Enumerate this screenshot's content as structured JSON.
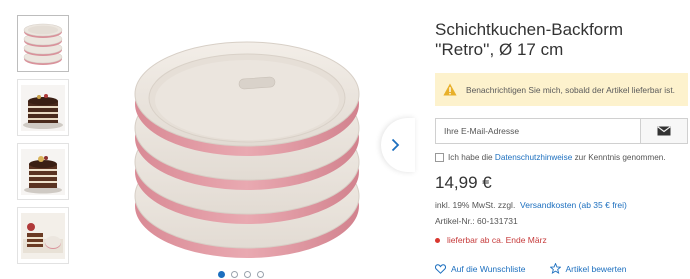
{
  "product": {
    "title_line1": "Schichtkuchen-Backform",
    "title_line2": "''Retro'', Ø 17 cm"
  },
  "notify": {
    "icon": "warning-icon",
    "text": "Benachrichtigen Sie mich, sobald der Artikel lieferbar ist.",
    "email_placeholder": "Ihre E-Mail-Adresse",
    "submit_icon": "envelope-icon"
  },
  "consent": {
    "prefix": "Ich habe die ",
    "link": "Datenschutzhinweise",
    "suffix": " zur Kenntnis genommen."
  },
  "pricing": {
    "price": "14,99 €",
    "vat_prefix": "inkl. 19% MwSt. zzgl. ",
    "shipping_link": "Versandkosten (ab 35 € frei)",
    "article_number": "Artikel-Nr.: 60-131731"
  },
  "availability": {
    "text": "lieferbar ab ca. Ende März",
    "status_color": "#d9372f"
  },
  "actions": {
    "wishlist": "Auf die Wunschliste",
    "rate": "Artikel bewerten"
  },
  "gallery": {
    "thumbnails": [
      "stacked-pans-thumbnail",
      "layer-cake-thumbnail-1",
      "layer-cake-thumbnail-2",
      "cake-slice-thumbnail"
    ],
    "active_index": 0,
    "dot_count": 4
  },
  "colors": {
    "link": "#1c6fbf",
    "notice_background": "#fdf2cd",
    "pan_rose": "#d9929b",
    "pan_cream": "#ece6df"
  }
}
